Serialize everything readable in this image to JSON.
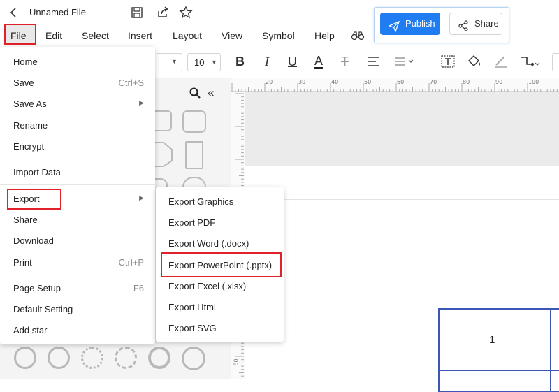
{
  "titlebar": {
    "file_title": "Unnamed File",
    "publish_label": "Publish",
    "share_label": "Share"
  },
  "menubar": {
    "items": [
      "File",
      "Edit",
      "Select",
      "Insert",
      "Layout",
      "View",
      "Symbol",
      "Help"
    ]
  },
  "toolbar": {
    "font_size": "10"
  },
  "file_menu": {
    "items": [
      {
        "label": "Home",
        "shortcut": ""
      },
      {
        "label": "Save",
        "shortcut": "Ctrl+S"
      },
      {
        "label": "Save As",
        "shortcut": ""
      },
      {
        "label": "Rename",
        "shortcut": ""
      },
      {
        "label": "Encrypt",
        "shortcut": ""
      },
      {
        "label": "Import Data",
        "shortcut": ""
      },
      {
        "label": "Export",
        "shortcut": ""
      },
      {
        "label": "Share",
        "shortcut": ""
      },
      {
        "label": "Download",
        "shortcut": ""
      },
      {
        "label": "Print",
        "shortcut": "Ctrl+P"
      },
      {
        "label": "Page Setup",
        "shortcut": "F6"
      },
      {
        "label": "Default Setting",
        "shortcut": ""
      },
      {
        "label": "Add star",
        "shortcut": ""
      }
    ]
  },
  "export_menu": {
    "items": [
      "Export Graphics",
      "Export PDF",
      "Export Word (.docx)",
      "Export PowerPoint (.pptx)",
      "Export Excel (.xlsx)",
      "Export Html",
      "Export SVG"
    ]
  },
  "ruler": {
    "top_numbers": [
      "20",
      "30",
      "40",
      "50",
      "60",
      "70",
      "80",
      "90",
      "100"
    ],
    "left_numbers": [
      "60"
    ]
  },
  "canvas": {
    "table_cell_1": "1"
  },
  "colors": {
    "accent": "#1f7cf1",
    "highlight_red": "#e0212a",
    "table_blue": "#3b56b5"
  }
}
